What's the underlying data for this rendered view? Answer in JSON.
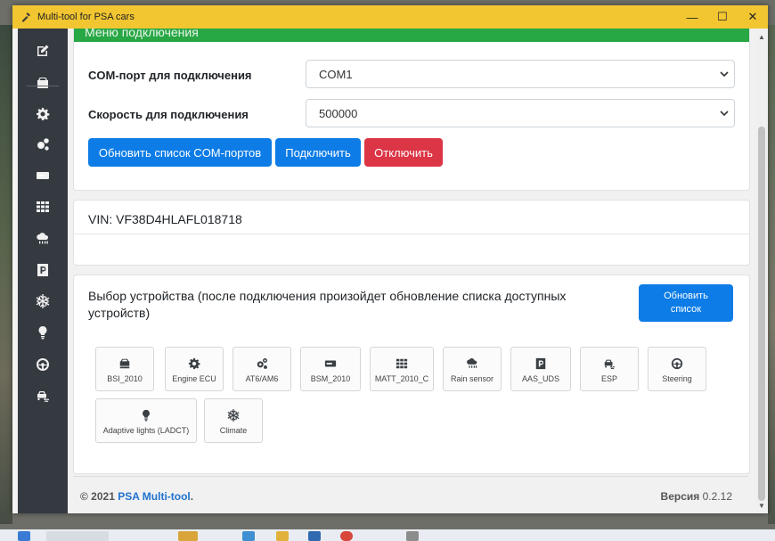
{
  "window": {
    "title": "Multi-tool for PSA cars"
  },
  "title_controls": {
    "minimize": "—",
    "maximize": "☐",
    "close": "✕"
  },
  "sidebar": {
    "items": [
      {
        "icon": "edit-icon"
      },
      {
        "icon": "car-ecu-icon"
      },
      {
        "icon": "gear-icon"
      },
      {
        "icon": "gears-icon"
      },
      {
        "icon": "module-icon"
      },
      {
        "icon": "grid-icon"
      },
      {
        "icon": "rain-sensor-icon"
      },
      {
        "icon": "parking-icon"
      },
      {
        "icon": "snowflake-icon"
      },
      {
        "icon": "bulb-icon"
      },
      {
        "icon": "steering-icon"
      },
      {
        "icon": "esp-car-icon"
      }
    ]
  },
  "connection": {
    "header": "Меню подключения",
    "port_label": "COM-порт для подключения",
    "port_value": "COM1",
    "speed_label": "Скорость для подключения",
    "speed_value": "500000",
    "btn_refresh_ports": "Обновить список COM-портов",
    "btn_connect": "Подключить",
    "btn_disconnect": "Отключить"
  },
  "vin": {
    "text": "VIN: VF38D4HLAFL018718"
  },
  "devices": {
    "title": "Выбор устройства (после подключения произойдет обновление списка доступных устройств)",
    "btn_refresh_line1": "Обновить",
    "btn_refresh_line2": "список",
    "tiles": [
      {
        "label": "BSI_2010",
        "icon": "car-ecu-icon"
      },
      {
        "label": "Engine ECU",
        "icon": "gear-icon"
      },
      {
        "label": "AT6/AM6",
        "icon": "gears-icon"
      },
      {
        "label": "BSM_2010",
        "icon": "module-icon"
      },
      {
        "label": "MATT_2010_C",
        "icon": "grid-icon"
      },
      {
        "label": "Rain sensor",
        "icon": "rain-sensor-icon"
      },
      {
        "label": "AAS_UDS",
        "icon": "parking-icon"
      },
      {
        "label": "ESP",
        "icon": "esp-car-icon"
      },
      {
        "label": "Steering",
        "icon": "steering-icon"
      },
      {
        "label": "Adaptive lights (LADCT)",
        "icon": "bulb-icon"
      },
      {
        "label": "Climate",
        "icon": "snowflake-icon"
      }
    ]
  },
  "footer": {
    "copyright": "© 2021",
    "brand": "PSA Multi-tool",
    "dot": ".",
    "version_label": "Версия",
    "version_value": "0.2.12"
  },
  "colors": {
    "title_bar": "#f2c631",
    "sidebar": "#343a40",
    "header_green": "#28a745",
    "primary": "#0d7ce6",
    "danger": "#dc3545"
  }
}
